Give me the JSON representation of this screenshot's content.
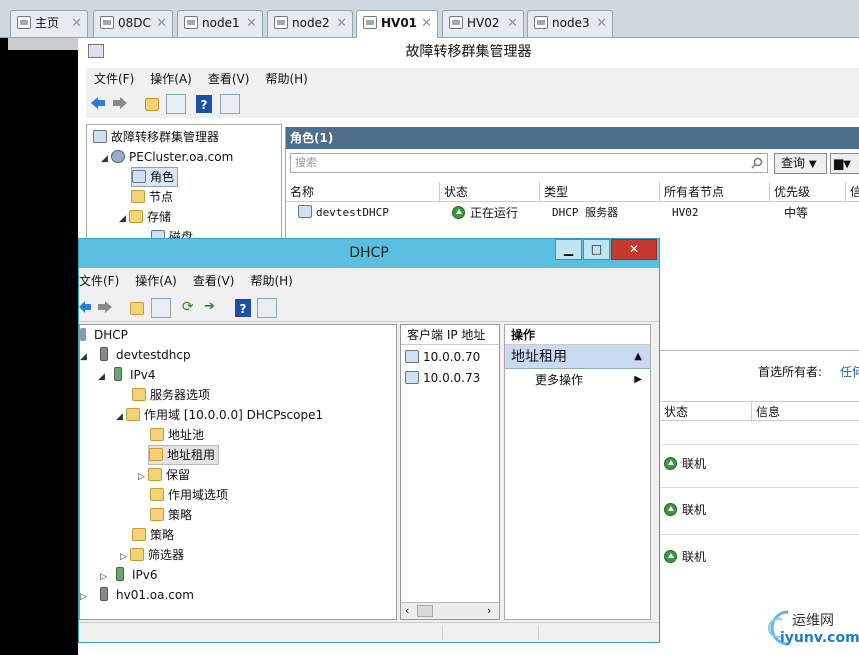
{
  "vm_tabs": [
    {
      "label": "主页",
      "active": false
    },
    {
      "label": "08DC",
      "active": false
    },
    {
      "label": "node1",
      "active": false
    },
    {
      "label": "node2",
      "active": false
    },
    {
      "label": "HV01",
      "active": true
    },
    {
      "label": "HV02",
      "active": false
    },
    {
      "label": "node3",
      "active": false
    }
  ],
  "fcm": {
    "title": "故障转移群集管理器",
    "menu": [
      "文件(F)",
      "操作(A)",
      "查看(V)",
      "帮助(H)"
    ],
    "tree": {
      "root": "故障转移群集管理器",
      "cluster": "PECluster.oa.com",
      "roles": "角色",
      "nodes": "节点",
      "storage": "存储",
      "disks": "磁盘"
    },
    "roles_header": "角色(1)",
    "search_placeholder": "搜索",
    "query_label": "查询",
    "columns": [
      "名称",
      "状态",
      "类型",
      "所有者节点",
      "优先级",
      "信"
    ],
    "row": {
      "name": "devtestDHCP",
      "status": "正在运行",
      "type": "DHCP 服务器",
      "owner": "HV02",
      "priority": "中等"
    },
    "preferred_owner_label": "首选所有者:",
    "preferred_owner_link": "任何",
    "resource_columns": [
      "状态",
      "信息"
    ],
    "resource_rows": [
      "联机",
      "联机",
      "联机"
    ]
  },
  "dhcp": {
    "title": "DHCP",
    "menu": [
      "文件(F)",
      "操作(A)",
      "查看(V)",
      "帮助(H)"
    ],
    "tree": {
      "root": "DHCP",
      "server": "devtestdhcp",
      "ipv4": "IPv4",
      "server_options": "服务器选项",
      "scope": "作用域 [10.0.0.0] DHCPscope1",
      "pool": "地址池",
      "leases": "地址租用",
      "reservations": "保留",
      "scope_options": "作用域选项",
      "scope_policies": "策略",
      "policies": "策略",
      "filters": "筛选器",
      "ipv6": "IPv6",
      "server2": "hv01.oa.com"
    },
    "lease_column": "客户端 IP 地址",
    "leases": [
      "10.0.0.70",
      "10.0.0.73"
    ],
    "actions_header": "操作",
    "actions_selected": "地址租用",
    "actions_more": "更多操作"
  },
  "watermark": {
    "line1": "运维网",
    "line2": "iyunv.com"
  }
}
